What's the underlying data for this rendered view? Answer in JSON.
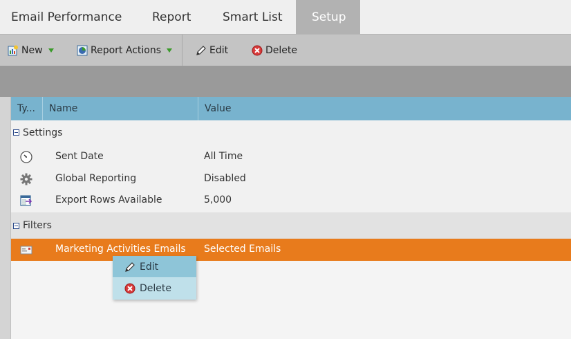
{
  "tabs": [
    {
      "label": "Email Performance",
      "active": false
    },
    {
      "label": "Report",
      "active": false
    },
    {
      "label": "Smart List",
      "active": false
    },
    {
      "label": "Setup",
      "active": true
    }
  ],
  "toolbar": {
    "new_label": "New",
    "report_actions_label": "Report Actions",
    "edit_label": "Edit",
    "delete_label": "Delete"
  },
  "grid": {
    "columns": [
      "Ty...",
      "Name",
      "Value"
    ],
    "groups": [
      {
        "label": "Settings",
        "rows": [
          {
            "icon": "clock-icon",
            "name": "Sent Date",
            "value": "All Time"
          },
          {
            "icon": "gear-icon",
            "name": "Global Reporting",
            "value": "Disabled"
          },
          {
            "icon": "export-icon",
            "name": "Export Rows Available",
            "value": "5,000"
          }
        ]
      },
      {
        "label": "Filters",
        "rows": [
          {
            "icon": "email-icon",
            "name": "Marketing Activities Emails",
            "value": "Selected Emails",
            "selected": true
          }
        ]
      }
    ]
  },
  "context_menu": {
    "items": [
      {
        "label": "Edit",
        "icon": "pencil-icon"
      },
      {
        "label": "Delete",
        "icon": "delete-icon"
      }
    ]
  },
  "colors": {
    "header_accent": "#78b3ce",
    "selected_row": "#e87b1c",
    "active_tab": "#b2b2b2"
  }
}
